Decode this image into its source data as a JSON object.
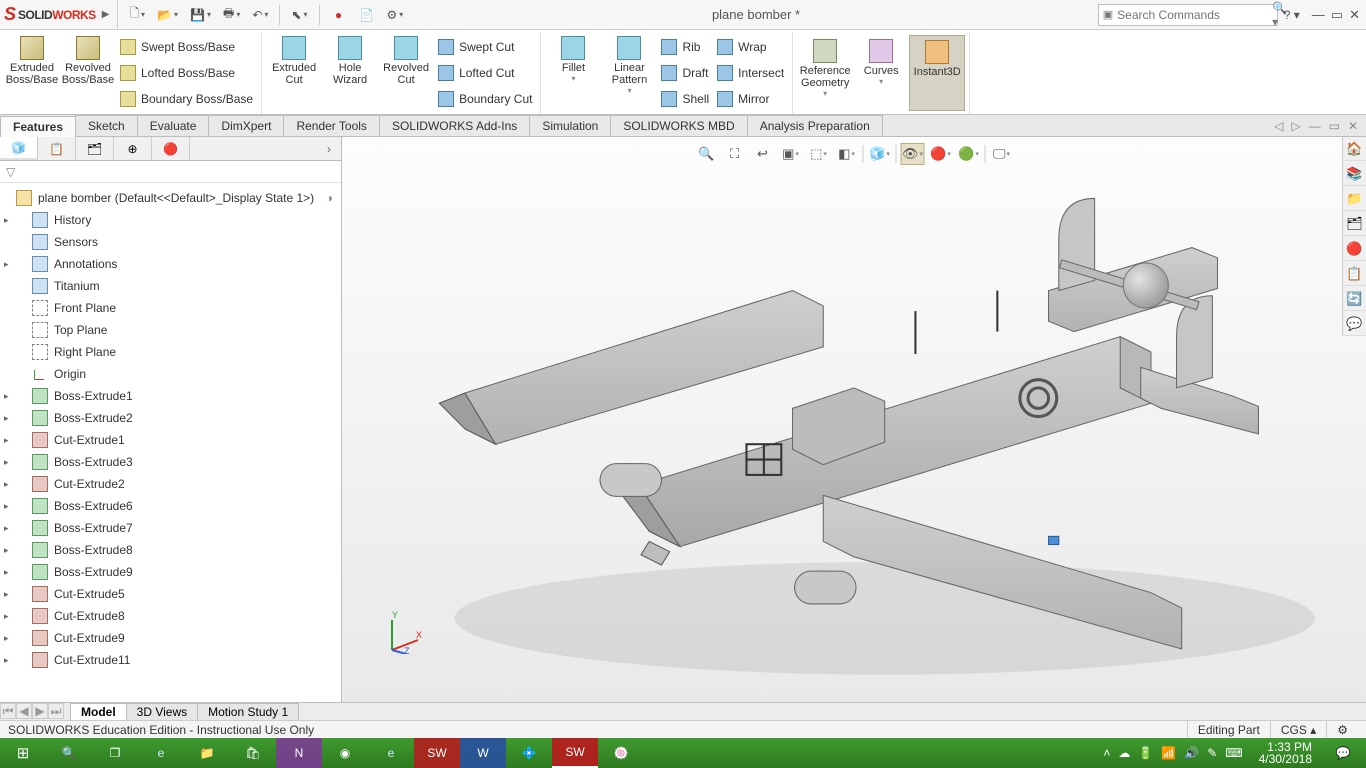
{
  "title": "plane bomber *",
  "search_placeholder": "Search Commands",
  "ribbon": {
    "groups": {
      "boss": {
        "extruded": "Extruded Boss/Base",
        "revolved": "Revolved Boss/Base",
        "swept": "Swept Boss/Base",
        "lofted": "Lofted Boss/Base",
        "boundary": "Boundary Boss/Base"
      },
      "cut": {
        "extruded": "Extruded Cut",
        "hole": "Hole Wizard",
        "revolved": "Revolved Cut",
        "swept": "Swept Cut",
        "lofted": "Lofted Cut",
        "boundary": "Boundary Cut"
      },
      "feat": {
        "fillet": "Fillet",
        "linear": "Linear Pattern",
        "rib": "Rib",
        "draft": "Draft",
        "shell": "Shell",
        "wrap": "Wrap",
        "intersect": "Intersect",
        "mirror": "Mirror"
      },
      "ref": {
        "refgeom": "Reference Geometry",
        "curves": "Curves",
        "instant3d": "Instant3D"
      }
    },
    "tabs": [
      "Features",
      "Sketch",
      "Evaluate",
      "DimXpert",
      "Render Tools",
      "SOLIDWORKS Add-Ins",
      "Simulation",
      "SOLIDWORKS MBD",
      "Analysis Preparation"
    ]
  },
  "tree": {
    "root": "plane bomber  (Default<<Default>_Display State 1>)",
    "items": [
      {
        "label": "History",
        "type": "folder",
        "exp": true
      },
      {
        "label": "Sensors",
        "type": "folder"
      },
      {
        "label": "Annotations",
        "type": "folder",
        "exp": true
      },
      {
        "label": "Titanium",
        "type": "material"
      },
      {
        "label": "Front Plane",
        "type": "plane"
      },
      {
        "label": "Top Plane",
        "type": "plane"
      },
      {
        "label": "Right Plane",
        "type": "plane"
      },
      {
        "label": "Origin",
        "type": "origin"
      },
      {
        "label": "Boss-Extrude1",
        "type": "feat",
        "exp": true
      },
      {
        "label": "Boss-Extrude2",
        "type": "feat",
        "exp": true
      },
      {
        "label": "Cut-Extrude1",
        "type": "cut",
        "exp": true
      },
      {
        "label": "Boss-Extrude3",
        "type": "feat",
        "exp": true
      },
      {
        "label": "Cut-Extrude2",
        "type": "cut",
        "exp": true
      },
      {
        "label": "Boss-Extrude6",
        "type": "feat",
        "exp": true
      },
      {
        "label": "Boss-Extrude7",
        "type": "feat",
        "exp": true
      },
      {
        "label": "Boss-Extrude8",
        "type": "feat",
        "exp": true
      },
      {
        "label": "Boss-Extrude9",
        "type": "feat",
        "exp": true
      },
      {
        "label": "Cut-Extrude5",
        "type": "cut",
        "exp": true
      },
      {
        "label": "Cut-Extrude8",
        "type": "cut",
        "exp": true
      },
      {
        "label": "Cut-Extrude9",
        "type": "cut",
        "exp": true
      },
      {
        "label": "Cut-Extrude11",
        "type": "cut",
        "exp": true
      }
    ]
  },
  "bottom_tabs": [
    "Model",
    "3D Views",
    "Motion Study 1"
  ],
  "status": {
    "left": "SOLIDWORKS Education Edition - Instructional Use Only",
    "mode": "Editing Part",
    "units": "CGS"
  },
  "clock": {
    "time": "1:33 PM",
    "date": "4/30/2018"
  },
  "triad": {
    "x": "X",
    "y": "Y",
    "z": "Z"
  }
}
